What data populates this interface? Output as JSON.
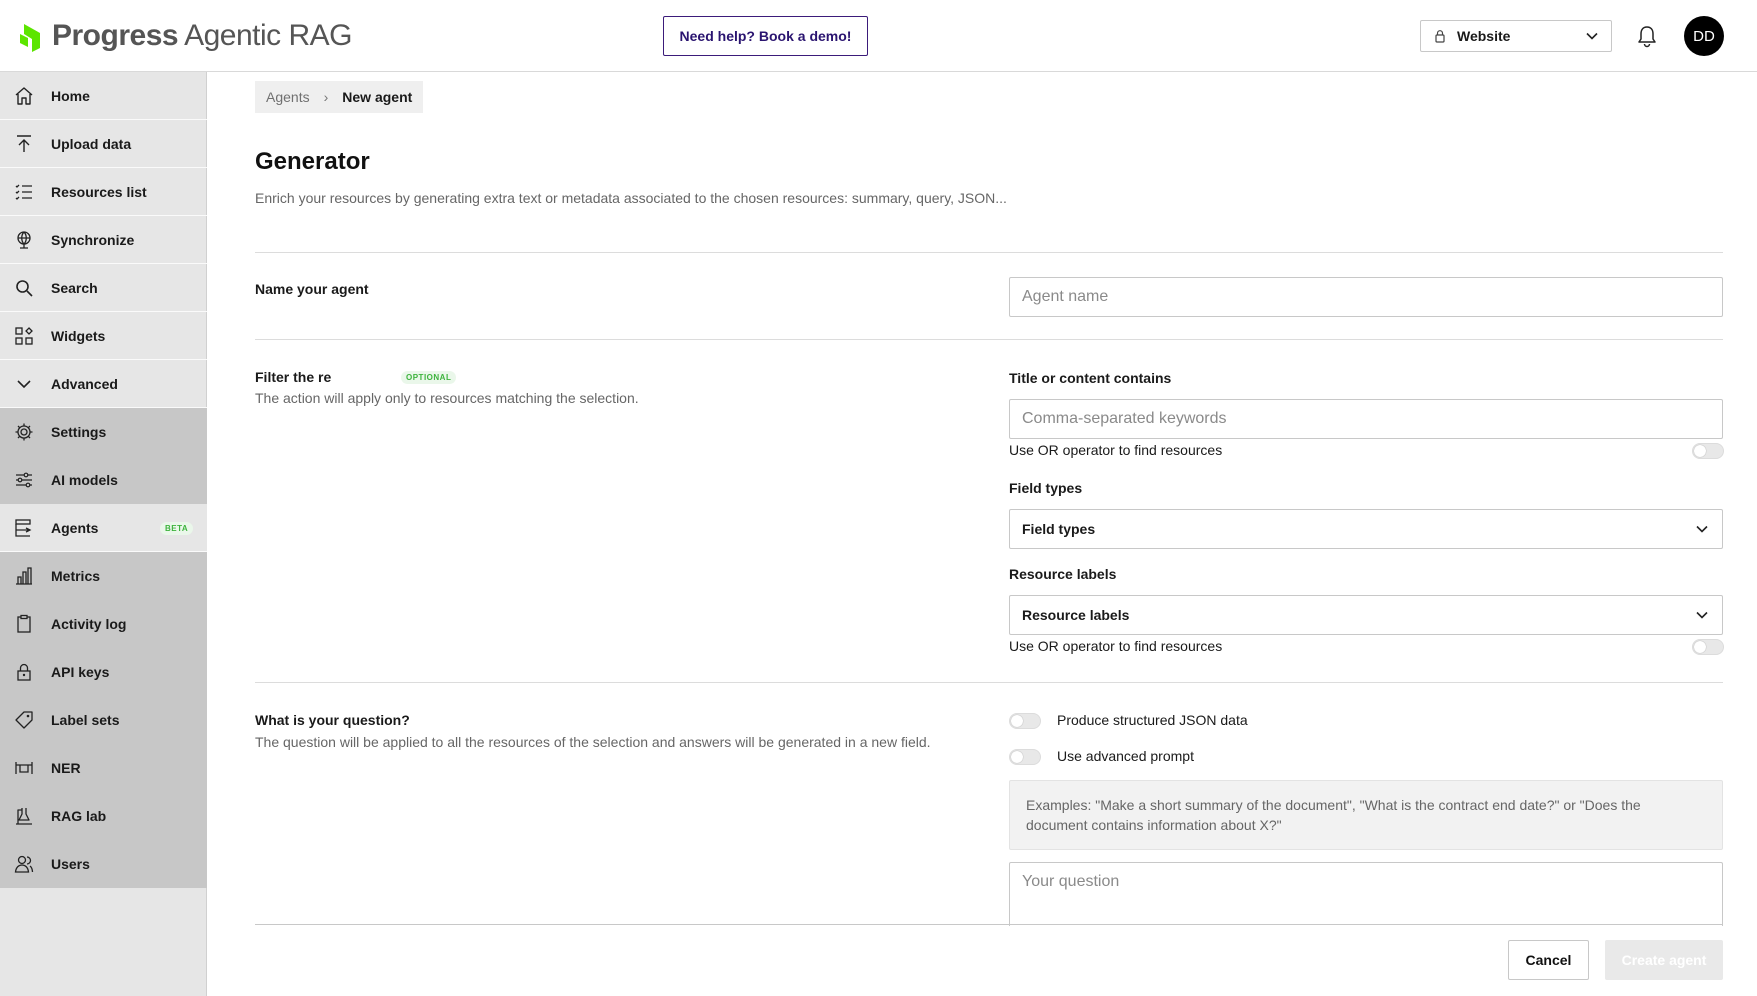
{
  "header": {
    "brand": "Progress",
    "product": "Agentic RAG",
    "help_button": "Need help? Book a demo!",
    "kb_selector": {
      "value": "Website",
      "icon": "lock-icon"
    },
    "notifications_icon": "bell-icon",
    "avatar_initials": "DD"
  },
  "sidebar": {
    "items": [
      {
        "label": "Home",
        "icon": "home-icon"
      },
      {
        "label": "Upload data",
        "icon": "upload-icon"
      },
      {
        "label": "Resources list",
        "icon": "list-icon"
      },
      {
        "label": "Synchronize",
        "icon": "globe-sync-icon"
      },
      {
        "label": "Search",
        "icon": "search-icon"
      },
      {
        "label": "Widgets",
        "icon": "widgets-icon"
      },
      {
        "label": "Advanced",
        "icon": "chevron-down-icon"
      },
      {
        "label": "Settings",
        "icon": "gear-icon"
      },
      {
        "label": "AI models",
        "icon": "sliders-icon"
      },
      {
        "label": "Agents",
        "icon": "agents-icon",
        "badge": "BETA"
      },
      {
        "label": "Metrics",
        "icon": "bar-chart-icon"
      },
      {
        "label": "Activity log",
        "icon": "clipboard-icon"
      },
      {
        "label": "API keys",
        "icon": "key-lock-icon"
      },
      {
        "label": "Label sets",
        "icon": "tag-icon"
      },
      {
        "label": "NER",
        "icon": "ner-icon"
      },
      {
        "label": "RAG lab",
        "icon": "flask-icon"
      },
      {
        "label": "Users",
        "icon": "users-icon"
      }
    ]
  },
  "breadcrumb": {
    "parent": "Agents",
    "current": "New agent"
  },
  "page": {
    "title": "Generator",
    "description": "Enrich your resources by generating extra text or metadata associated to the chosen resources: summary, query, JSON..."
  },
  "form": {
    "name_section": {
      "label": "Name your agent",
      "placeholder": "Agent name"
    },
    "filter_section": {
      "label": "Filter the re",
      "badge": "OPTIONAL",
      "help": "The action will apply only to resources matching the selection.",
      "title_contains_label": "Title or content contains",
      "keywords_placeholder": "Comma-separated keywords",
      "or_operator_label": "Use OR operator to find resources",
      "field_types_label": "Field types",
      "field_types_value": "Field types",
      "resource_labels_label": "Resource labels",
      "resource_labels_value": "Resource labels",
      "labels_or_operator_label": "Use OR operator to find resources"
    },
    "question_section": {
      "label": "What is your question?",
      "help": "The question will be applied to all the resources of the selection and answers will be generated in a new field.",
      "json_toggle_label": "Produce structured JSON data",
      "advanced_prompt_label": "Use advanced prompt",
      "examples": "Examples: \"Make a short summary of the document\", \"What is the contract end date?\" or \"Does the document contains information about X?\"",
      "question_placeholder": "Your question"
    }
  },
  "footer": {
    "cancel": "Cancel",
    "create": "Create agent"
  },
  "colors": {
    "accent_green": "#3db33d",
    "help_purple": "#2a1470",
    "sidebar_dark": "#c7c7c7",
    "sidebar_light": "#e6e6e6"
  }
}
